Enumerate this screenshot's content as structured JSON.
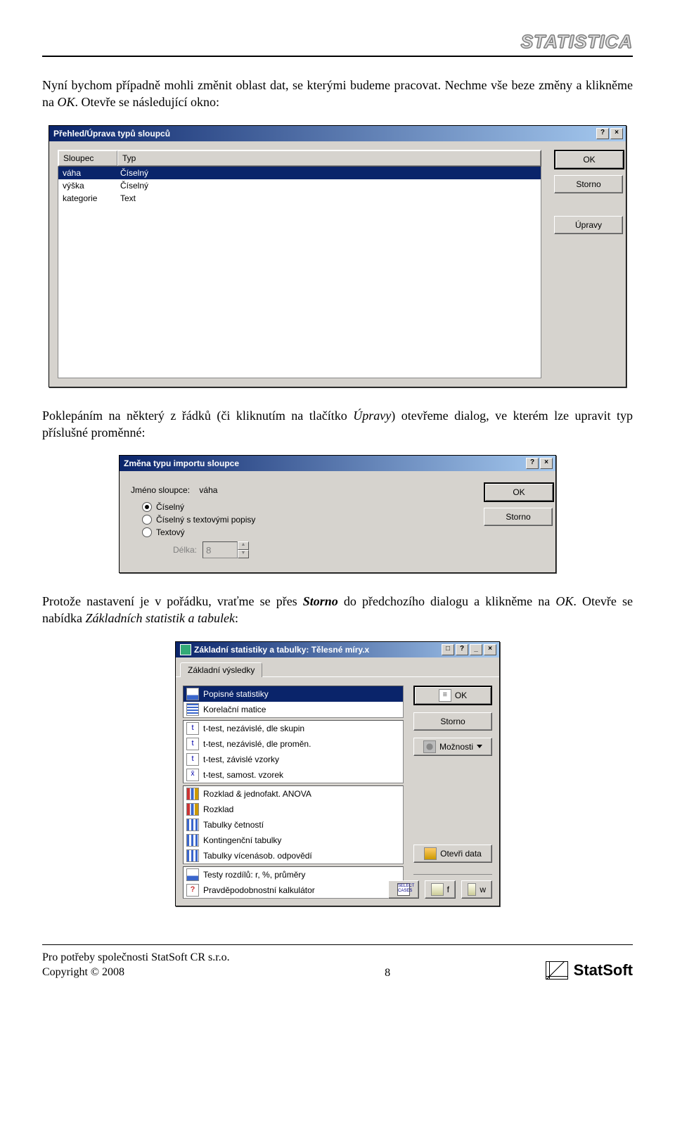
{
  "header": {
    "brand": "STATISTICA"
  },
  "para1": {
    "pre": "Nyní bychom případně mohli změnit oblast dat, se kterými budeme pracovat. Nechme vše beze změny a klikněme na ",
    "ok": "OK",
    "post": ". Otevře se následující okno:"
  },
  "dlg1": {
    "title": "Přehled/Úprava typů sloupců",
    "help": "?",
    "close": "×",
    "headers": {
      "col1": "Sloupec",
      "col2": "Typ"
    },
    "rows": [
      {
        "name": "váha",
        "type": "Číselný",
        "selected": true
      },
      {
        "name": "výška",
        "type": "Číselný",
        "selected": false
      },
      {
        "name": "kategorie",
        "type": "Text",
        "selected": false
      }
    ],
    "buttons": {
      "ok": "OK",
      "storno": "Storno",
      "upravy": "Úpravy"
    }
  },
  "para2": {
    "pre": "Poklepáním na některý z řádků (či kliknutím na tlačítko ",
    "em": "Úpravy",
    "post": ") otevřeme dialog, ve kterém lze upravit typ příslušné proměnné:"
  },
  "dlg2": {
    "title": "Změna typu importu sloupce",
    "help": "?",
    "close": "×",
    "label_name": "Jméno sloupce:",
    "value_name": "váha",
    "radios": {
      "r1": "Číselný",
      "r2": "Číselný s textovými popisy",
      "r3": "Textový"
    },
    "length_label": "Délka:",
    "length_value": "8",
    "buttons": {
      "ok": "OK",
      "storno": "Storno"
    }
  },
  "para3": {
    "pre": "Protože nastavení je v pořádku, vraťme se přes ",
    "storno": "Storno",
    "mid": " do předchozího dialogu a klikněme na ",
    "ok": "OK",
    "post1": ". Otevře se nabídka ",
    "em": "Základních statistik a tabulek",
    "post2": ":"
  },
  "dlg3": {
    "title": "Základní statistiky a tabulky: Tělesné míry.x",
    "restore": "□",
    "help": "?",
    "min": "_",
    "close": "×",
    "tab": "Základní výsledky",
    "items": {
      "g1": [
        {
          "label": "Popisné statistiky",
          "icon": "i-chart",
          "selected": true
        },
        {
          "label": "Korelační matice",
          "icon": "i-grid"
        }
      ],
      "g2": [
        {
          "label": "t-test, nezávislé, dle skupin",
          "icon": "i-t"
        },
        {
          "label": "t-test, nezávislé, dle proměn.",
          "icon": "i-t"
        },
        {
          "label": "t-test, závislé vzorky",
          "icon": "i-t"
        },
        {
          "label": "t-test, samost. vzorek",
          "icon": "i-x"
        }
      ],
      "g3": [
        {
          "label": "Rozklad & jednofakt. ANOVA",
          "icon": "i-bars"
        },
        {
          "label": "Rozklad",
          "icon": "i-bars"
        },
        {
          "label": "Tabulky četností",
          "icon": "i-tbl"
        },
        {
          "label": "Kontingenční tabulky",
          "icon": "i-tbl"
        },
        {
          "label": "Tabulky vícenásob. odpovědí",
          "icon": "i-tbl"
        }
      ],
      "g4": [
        {
          "label": "Testy rozdílů: r, %, průměry",
          "icon": "i-chart"
        },
        {
          "label": "Pravděpodobnostní kalkulátor",
          "icon": "i-q"
        }
      ]
    },
    "buttons": {
      "ok": "OK",
      "storno": "Storno",
      "moznosti": "Možnosti",
      "open": "Otevři data",
      "f": "f",
      "w": "w"
    }
  },
  "footer": {
    "line1": "Pro potřeby společnosti StatSoft CR s.r.o.",
    "line2": "Copyright © 2008",
    "page": "8",
    "logo": "StatSoft"
  }
}
